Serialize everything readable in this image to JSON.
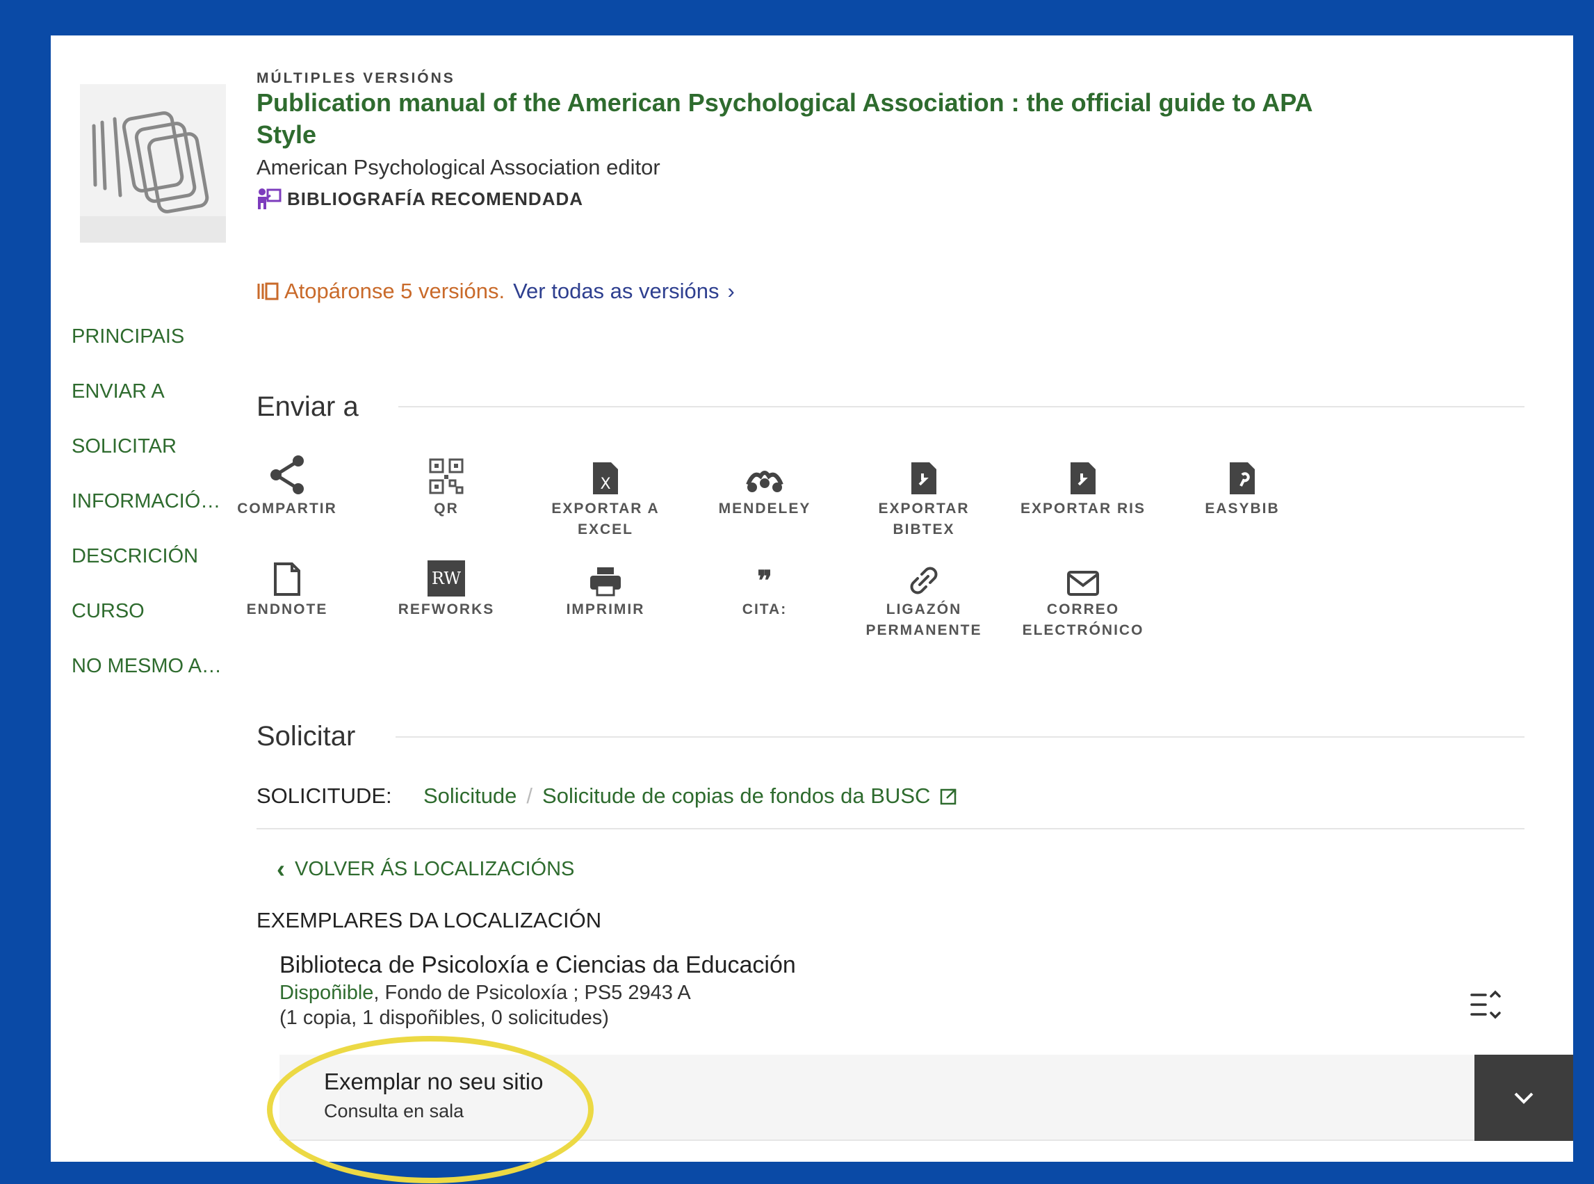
{
  "record": {
    "overline": "MÚLTIPLES VERSIÓNS",
    "title": "Publication manual of the American Psychological Association : the official guide to APA Style",
    "author": "American Psychological Association editor",
    "badge": "BIBLIOGRAFÍA RECOMENDADA",
    "versions_found": "Atopáronse 5 versións.",
    "versions_link": "Ver todas as versións",
    "versions_chevron": "›"
  },
  "nav": {
    "items": [
      "PRINCIPAIS",
      "ENVIAR A",
      "SOLICITAR",
      "INFORMACIÓN…",
      "DESCRICIÓN",
      "CURSO",
      "NO MESMO AN…"
    ]
  },
  "send": {
    "heading": "Enviar a",
    "actions": [
      {
        "label": "COMPARTIR",
        "icon": "share-icon"
      },
      {
        "label": "QR",
        "icon": "qr-code-icon"
      },
      {
        "label": "EXPORTAR A EXCEL",
        "icon": "excel-file-icon"
      },
      {
        "label": "MENDELEY",
        "icon": "mendeley-icon"
      },
      {
        "label": "EXPORTAR BIBTEX",
        "icon": "bibtex-file-icon"
      },
      {
        "label": "EXPORTAR RIS",
        "icon": "ris-file-icon"
      },
      {
        "label": "EASYBIB",
        "icon": "easybib-icon"
      },
      {
        "label": "ENDNOTE",
        "icon": "endnote-file-icon"
      },
      {
        "label": "REFWORKS",
        "icon": "refworks-icon",
        "icon_text": "RW"
      },
      {
        "label": "IMPRIMIR",
        "icon": "printer-icon"
      },
      {
        "label": "CITA:",
        "icon": "quote-icon",
        "icon_text": "❞"
      },
      {
        "label": "LIGAZÓN PERMANENTE",
        "icon": "link-icon"
      },
      {
        "label": "CORREO ELECTRÓNICO",
        "icon": "email-icon"
      }
    ]
  },
  "request": {
    "heading": "Solicitar",
    "label": "SOLICITUDE:",
    "links": [
      "Solicitude",
      "Solicitude de copias de fondos da BUSC"
    ],
    "separator": "/",
    "back": "VOLVER ÁS LOCALIZACIÓNS",
    "back_chevron": "‹",
    "copies_heading": "EXEMPLARES DA LOCALIZACIÓN",
    "location": {
      "name": "Biblioteca de Psicoloxía e Ciencias da Educación",
      "availability": "Dispoñible",
      "details": ", Fondo de Psicoloxía ; PS5 2943 A",
      "counts": "(1 copia, 1 dispoñibles, 0 solicitudes)"
    },
    "item": {
      "title": "Exemplar no seu sitio",
      "subtitle": "Consulta en sala"
    }
  },
  "colors": {
    "frame": "#0a4aa6",
    "accent_green": "#2e6b2e",
    "found_orange": "#c96a2a",
    "link_blue": "#2e3f8f",
    "highlight": "#ecd944"
  }
}
